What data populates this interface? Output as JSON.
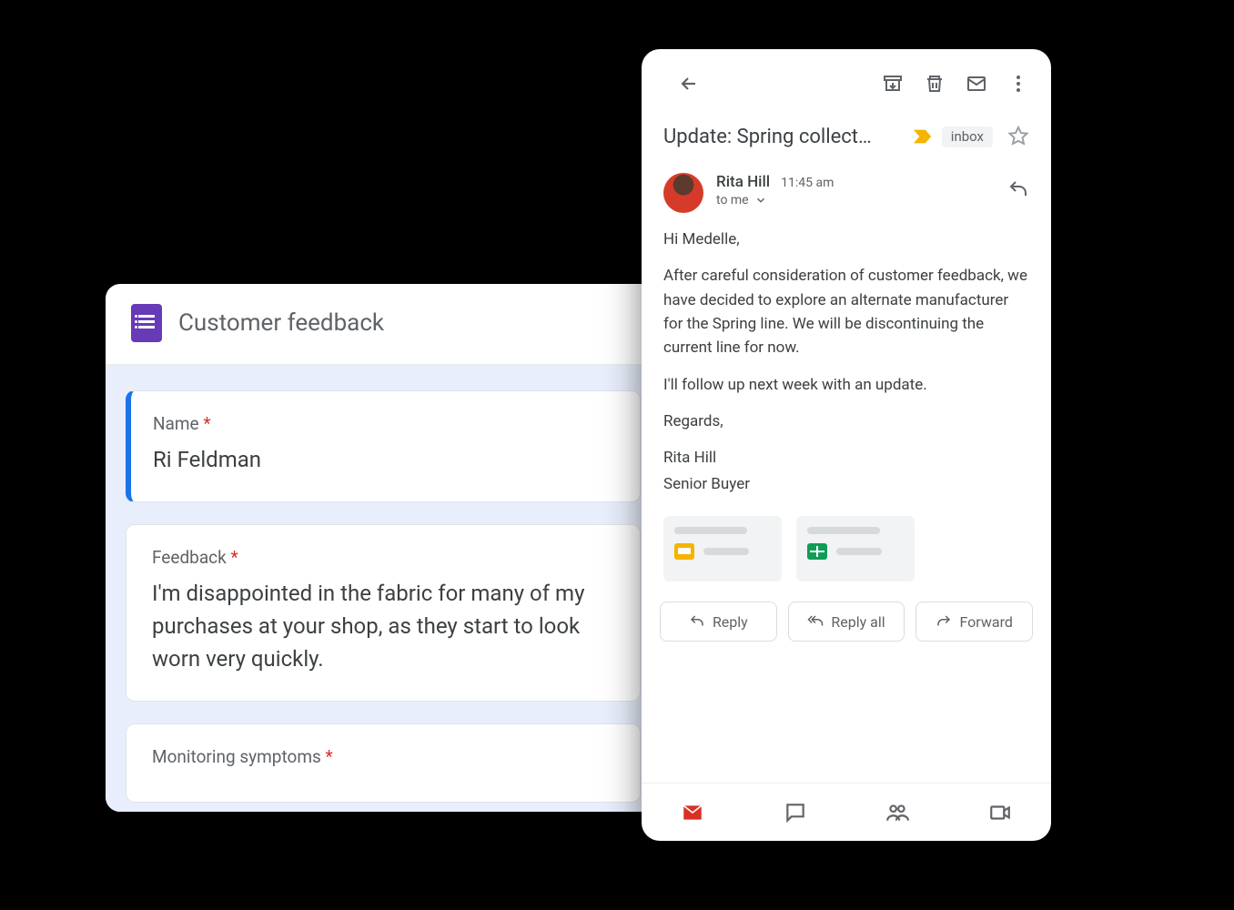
{
  "forms": {
    "title": "Customer feedback",
    "fields": [
      {
        "label": "Name",
        "required": true,
        "value": "Ri Feldman"
      },
      {
        "label": "Feedback",
        "required": true,
        "value": "I'm disappointed in the fabric for many of my purchases at your shop, as they start to look worn very quickly."
      },
      {
        "label": "Monitoring symptoms",
        "required": true,
        "value": ""
      }
    ]
  },
  "gmail": {
    "subject": "Update: Spring collect…",
    "inbox_chip": "inbox",
    "sender": {
      "name": "Rita Hill",
      "time": "11:45 am",
      "to": "to me"
    },
    "body": {
      "greeting": "Hi Medelle,",
      "p1": "After careful consideration of customer feedback, we have decided to explore an alternate manufacturer for the Spring line. We will be discontinuing the current line for now.",
      "p2": "I'll follow up next week with an update.",
      "closing": "Regards,",
      "sig_name": "Rita Hill",
      "sig_title": "Senior Buyer"
    },
    "actions": {
      "reply": "Reply",
      "reply_all": "Reply all",
      "forward": "Forward"
    }
  }
}
